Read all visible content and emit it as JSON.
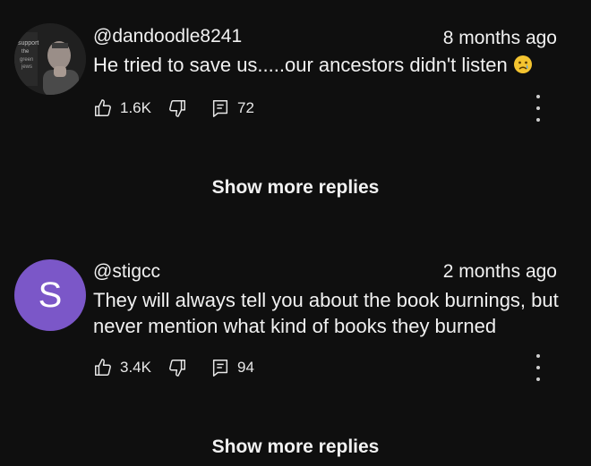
{
  "comments": [
    {
      "author": "@dandoodle8241",
      "time": "8 months ago",
      "text": "He tried to save us.....our ancestors didn't listen",
      "emoji": "crying-face-emoji",
      "likes": "1.6K",
      "replies": "72",
      "avatar": {
        "type": "photo",
        "sign_text": "support the"
      }
    },
    {
      "author": "@stigcc",
      "time": "2 months ago",
      "text": "They will always tell you about the book burnings, but never mention what kind of books they burned",
      "likes": "3.4K",
      "replies": "94",
      "avatar": {
        "type": "letter",
        "letter": "S",
        "color": "#7b57c8"
      }
    }
  ],
  "show_more_label": "Show more replies",
  "colors": {
    "background": "#0f0f0f",
    "text": "#f1f1f1",
    "avatar_letter_bg": "#7b57c8",
    "emoji": "#f4c430"
  },
  "icons": [
    "thumbs-up-icon",
    "thumbs-down-icon",
    "reply-icon",
    "more-vert-icon",
    "crying-face-emoji"
  ]
}
